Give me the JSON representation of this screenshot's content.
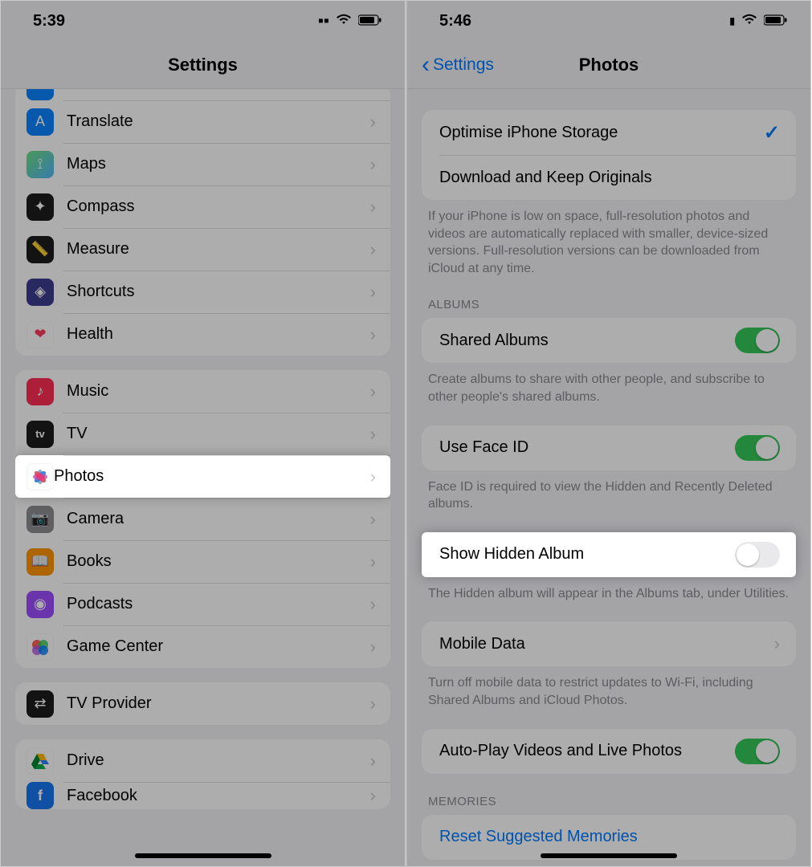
{
  "left": {
    "time": "5:39",
    "title": "Settings",
    "group1": [
      {
        "label": "Translate",
        "icon": "🔤",
        "bg": "#0a84ff"
      },
      {
        "label": "Maps",
        "icon": "🗺️",
        "bg": "#5fc364"
      },
      {
        "label": "Compass",
        "icon": "🧭",
        "bg": "#1c1c1e"
      },
      {
        "label": "Measure",
        "icon": "📏",
        "bg": "#1c1c1e"
      },
      {
        "label": "Shortcuts",
        "icon": "⟐",
        "bg": "#3a3a8c"
      },
      {
        "label": "Health",
        "icon": "❤",
        "bg": "#ffffff",
        "fg": "#ff3b5c"
      }
    ],
    "group2": [
      {
        "label": "Music",
        "icon": "♪",
        "bg": "#ff2d55"
      },
      {
        "label": "TV",
        "icon": "tv",
        "bg": "#1c1c1e"
      },
      {
        "label": "Photos",
        "icon": "photos",
        "highlight": true
      },
      {
        "label": "Camera",
        "icon": "📷",
        "bg": "#8e8e93"
      },
      {
        "label": "Books",
        "icon": "📖",
        "bg": "#ff9500"
      },
      {
        "label": "Podcasts",
        "icon": "🟣",
        "bg": "#9c4dff"
      },
      {
        "label": "Game Center",
        "icon": "🎮",
        "bg": "#ffffff"
      }
    ],
    "group3": [
      {
        "label": "TV Provider",
        "icon": "⇄",
        "bg": "#1c1c1e"
      }
    ],
    "group4": [
      {
        "label": "Drive",
        "icon": "▲",
        "bg": "#ffffff"
      },
      {
        "label": "Facebook",
        "icon": "f",
        "bg": "#1877f2"
      }
    ]
  },
  "right": {
    "time": "5:46",
    "back": "Settings",
    "title": "Photos",
    "storage": {
      "optimise": "Optimise iPhone Storage",
      "download": "Download and Keep Originals",
      "footer": "If your iPhone is low on space, full-resolution photos and videos are automatically replaced with smaller, device-sized versions. Full-resolution versions can be downloaded from iCloud at any time."
    },
    "albums_header": "ALBUMS",
    "shared": {
      "label": "Shared Albums",
      "footer": "Create albums to share with other people, and subscribe to other people's shared albums."
    },
    "faceid": {
      "label": "Use Face ID",
      "footer": "Face ID is required to view the Hidden and Recently Deleted albums."
    },
    "hidden": {
      "label": "Show Hidden Album",
      "footer": "The Hidden album will appear in the Albums tab, under Utilities."
    },
    "mobile": {
      "label": "Mobile Data",
      "footer": "Turn off mobile data to restrict updates to Wi-Fi, including Shared Albums and iCloud Photos."
    },
    "autoplay": {
      "label": "Auto-Play Videos and Live Photos"
    },
    "memories_header": "MEMORIES",
    "reset": "Reset Suggested Memories"
  }
}
